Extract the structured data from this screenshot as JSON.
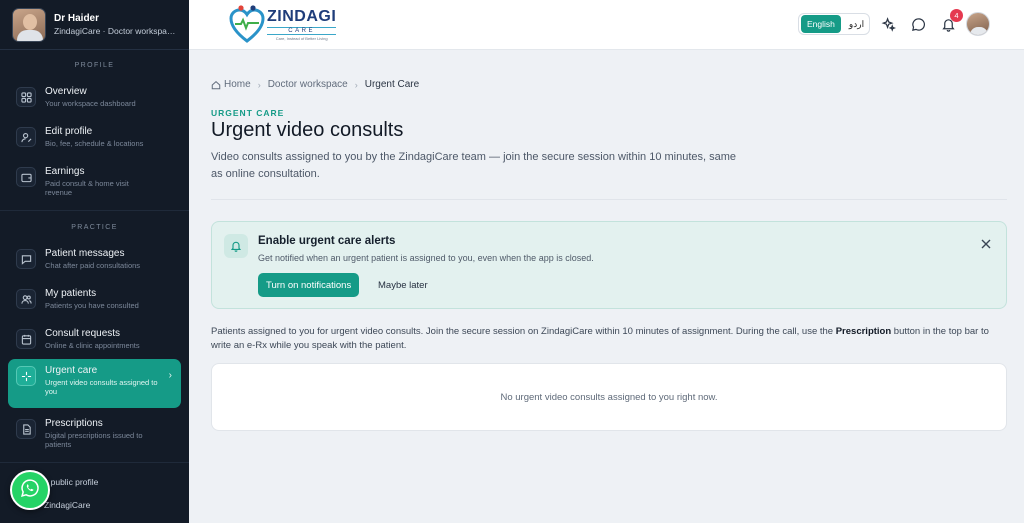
{
  "sidebar": {
    "user_name": "Dr Haider",
    "user_sub": "ZindagiCare · Doctor workspa…",
    "section_profile": "PROFILE",
    "section_practice": "PRACTICE",
    "items": [
      {
        "label": "Overview",
        "desc": "Your workspace dashboard",
        "icon": "grid-icon"
      },
      {
        "label": "Edit profile",
        "desc": "Bio, fee, schedule & locations",
        "icon": "user-edit-icon"
      },
      {
        "label": "Earnings",
        "desc": "Paid consult & home visit revenue",
        "icon": "wallet-icon"
      },
      {
        "label": "Patient messages",
        "desc": "Chat after paid consultations",
        "icon": "chat-icon"
      },
      {
        "label": "My patients",
        "desc": "Patients you have consulted",
        "icon": "users-icon"
      },
      {
        "label": "Consult requests",
        "desc": "Online & clinic appointments",
        "icon": "calendar-icon"
      },
      {
        "label": "Urgent care",
        "desc": "Urgent video consults assigned to you",
        "icon": "sparkle-icon",
        "active": true
      },
      {
        "label": "Prescriptions",
        "desc": "Digital prescriptions issued to patients",
        "icon": "document-icon"
      }
    ],
    "links": [
      "y public profile",
      "ZindagiCare"
    ]
  },
  "header": {
    "logo_name": "ZINDAGI",
    "logo_sub": "CARE",
    "logo_tag": "Care, Instead of Better Living",
    "lang_en": "English",
    "lang_ur": "اردو",
    "notification_count": "4"
  },
  "main": {
    "breadcrumb": {
      "home": "Home",
      "workspace": "Doctor workspace",
      "current": "Urgent Care"
    },
    "eyebrow": "URGENT CARE",
    "title": "Urgent video consults",
    "subtitle": "Video consults assigned to you by the ZindagiCare team — join the secure session within 10 minutes, same as online consultation.",
    "alert": {
      "title": "Enable urgent care alerts",
      "desc": "Get notified when an urgent patient is assigned to you, even when the app is closed.",
      "primary": "Turn on notifications",
      "secondary": "Maybe later"
    },
    "info_part1": "Patients assigned to you for urgent video consults. Join the secure session on ZindagiCare within 10 minutes of assignment. During the call, use the ",
    "info_bold": "Prescription",
    "info_part2": " button in the top bar to write an e-Rx while you speak with the patient.",
    "empty": "No urgent video consults assigned to you right now."
  },
  "colors": {
    "accent": "#159b87",
    "sidebar_bg": "#131b27",
    "badge": "#e53950",
    "whatsapp": "#25d366"
  }
}
